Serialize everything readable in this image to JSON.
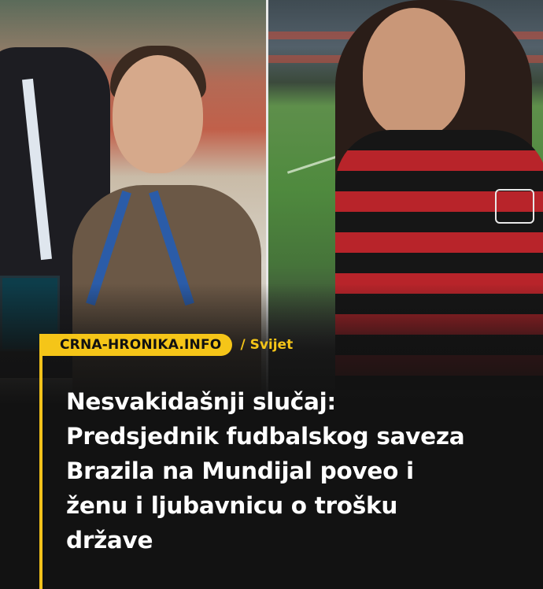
{
  "header": {
    "source": "CRNA-HRONIKA.INFO",
    "category": "/ Svijet"
  },
  "headline": {
    "lines": [
      "Nesvakidašnji slučaj:",
      "Predsjednik fudbalskog saveza",
      "Brazila na Mundijal poveo i",
      "ženu i ljubavnicu o trošku",
      "države"
    ]
  },
  "colors": {
    "accent": "#f5c518",
    "background": "#121212",
    "headline_text": "#ffffff"
  }
}
